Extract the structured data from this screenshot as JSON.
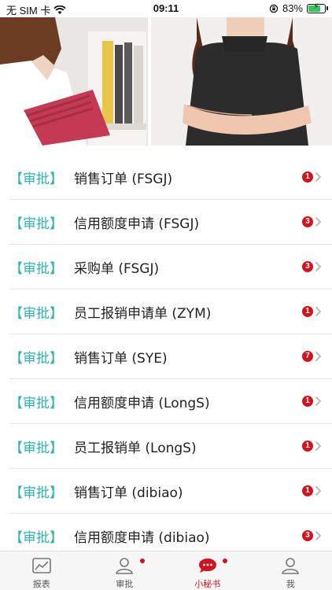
{
  "status_bar": {
    "carrier": "无 SIM 卡",
    "time": "09:11",
    "battery": "83%",
    "battery_level": 0.83,
    "wifi_icon": "wifi-icon",
    "lock_icon": "orientation-lock-icon"
  },
  "approvals": [
    {
      "tag": "【审批】",
      "title": "销售订单 (FSGJ)",
      "count": "1"
    },
    {
      "tag": "【审批】",
      "title": "信用额度申请 (FSGJ)",
      "count": "3"
    },
    {
      "tag": "【审批】",
      "title": "采购单 (FSGJ)",
      "count": "3"
    },
    {
      "tag": "【审批】",
      "title": "员工报销申请单 (ZYM)",
      "count": "1"
    },
    {
      "tag": "【审批】",
      "title": "销售订单 (SYE)",
      "count": "7"
    },
    {
      "tag": "【审批】",
      "title": "信用额度申请 (LongS)",
      "count": "1"
    },
    {
      "tag": "【审批】",
      "title": "员工报销单 (LongS)",
      "count": "1"
    },
    {
      "tag": "【审批】",
      "title": "销售订单 (dibiao)",
      "count": "1"
    },
    {
      "tag": "【审批】",
      "title": "信用额度申请 (dibiao)",
      "count": "3"
    }
  ],
  "tabbar": {
    "tabs": [
      {
        "label": "报表",
        "icon": "chart-icon",
        "dot": false
      },
      {
        "label": "审批",
        "icon": "user-icon",
        "dot": true
      },
      {
        "label": "小秘书",
        "icon": "chat-bubble-icon",
        "dot": true,
        "active": true
      },
      {
        "label": "我",
        "icon": "person-icon",
        "dot": false
      }
    ]
  },
  "colors": {
    "accent_teal": "#2bb5ae",
    "badge_red": "#d3121b",
    "active_tab": "#d3121b"
  }
}
